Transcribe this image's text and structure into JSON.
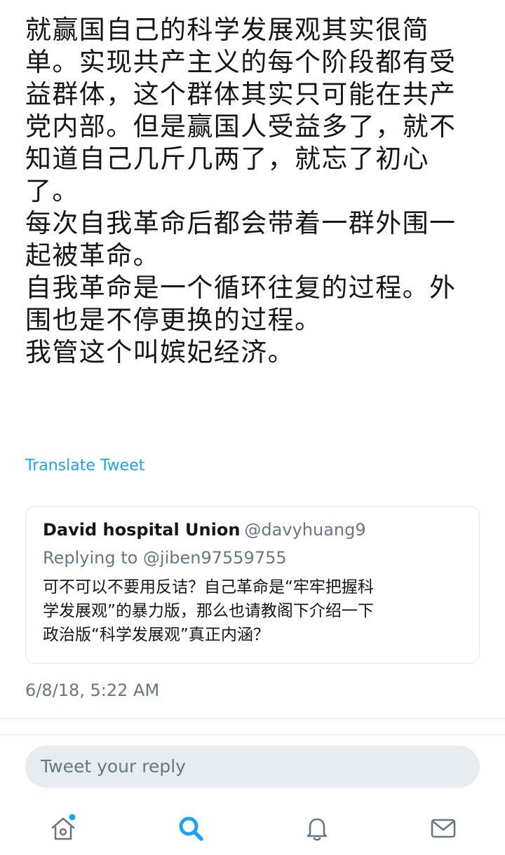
{
  "tweet": {
    "lines": [
      "就赢国自己的科学发展观其实很简",
      "单。实现共产主义的每个阶段都有受",
      "益群体，这个群体其实只可能在共产",
      "党内部。但是赢国人受益多了，就不",
      "知道自己几斤几两了，就忘了初心",
      "了。",
      "每次自我革命后都会带着一群外围一",
      "起被革命。",
      "自我革命是一个循环往复的过程。外",
      "围也是不停更换的过程。",
      "我管这个叫嫔妃经济。"
    ],
    "translate_label": "Translate Tweet",
    "timestamp": "6/8/18, 5:22 AM"
  },
  "quoted_tweet": {
    "name": "David hospital Union",
    "handle": "@davyhuang9",
    "replying_to": "Replying to @jiben97559755",
    "lines": [
      "可不可以不要用反诘？自己革命是“牢牢把握科",
      "学发展观”的暴力版，那么也请教阁下介绍一下",
      "政治版“科学发展观”真正内涵？"
    ]
  },
  "reply": {
    "placeholder": "Tweet your reply"
  },
  "tab_bar": {
    "items": [
      {
        "icon": "home-icon",
        "active": false,
        "has_dot": true
      },
      {
        "icon": "search-icon",
        "active": true
      },
      {
        "icon": "bell-icon",
        "active": false
      },
      {
        "icon": "mail-icon",
        "active": false
      }
    ]
  },
  "colors": {
    "accent": "#1da1f2",
    "text": "#14171a",
    "secondary": "#657786",
    "border": "#e1e8ed",
    "reply_bg": "#e6ecf0"
  }
}
